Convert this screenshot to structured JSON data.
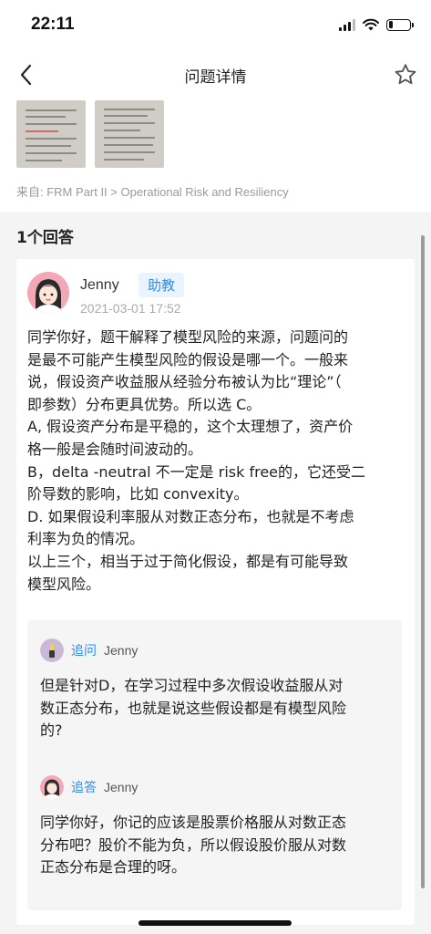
{
  "status_bar": {
    "time": "22:11",
    "battery_level": 0.22
  },
  "nav": {
    "title": "问题详情",
    "back_icon": "chevron-left-icon",
    "favorite_icon": "star-outline-icon"
  },
  "question": {
    "source": "来自: FRM Part II > Operational Risk and Resiliency"
  },
  "answers": {
    "count_label": "1个回答",
    "items": [
      {
        "author": "Jenny",
        "role": "助教",
        "time": "2021-03-01 17:52",
        "body_lines": [
          "同学你好，题干解释了模型风险的来源，问题问的",
          "是最不可能产生模型风险的假设是哪一个。一般来",
          "说，假设资产收益服从经验分布被认为比“理论”（",
          "即参数）分布更具优势。所以选 C。",
          "A, 假设资产分布是平稳的，这个太理想了，资产价",
          "格一般是会随时间波动的。",
          "B，delta -neutral 不一定是 risk free的，它还受二",
          "阶导数的影响，比如 convexity。",
          "D. 如果假设利率服从对数正态分布，也就是不考虑",
          "利率为负的情况。",
          "以上三个，相当于过于简化假设，都是有可能导致",
          "模型风险。"
        ],
        "replies": [
          {
            "kind": "追问",
            "name": "Jenny",
            "lines": [
              "但是针对D，在学习过程中多次假设收益服从对",
              "数正态分布，也就是说这些假设都是有模型风险",
              "的?"
            ]
          },
          {
            "kind": "追答",
            "name": "Jenny",
            "lines": [
              "同学你好，你记的应该是股票价格服从对数正态",
              "分布吧？股价不能为负，所以假设股价服从对数",
              "正态分布是合理的呀。"
            ]
          }
        ]
      }
    ]
  },
  "colors": {
    "accent": "#2b8cf0",
    "background_gray": "#f4f4f4",
    "badge_bg": "#eaf4fe"
  }
}
